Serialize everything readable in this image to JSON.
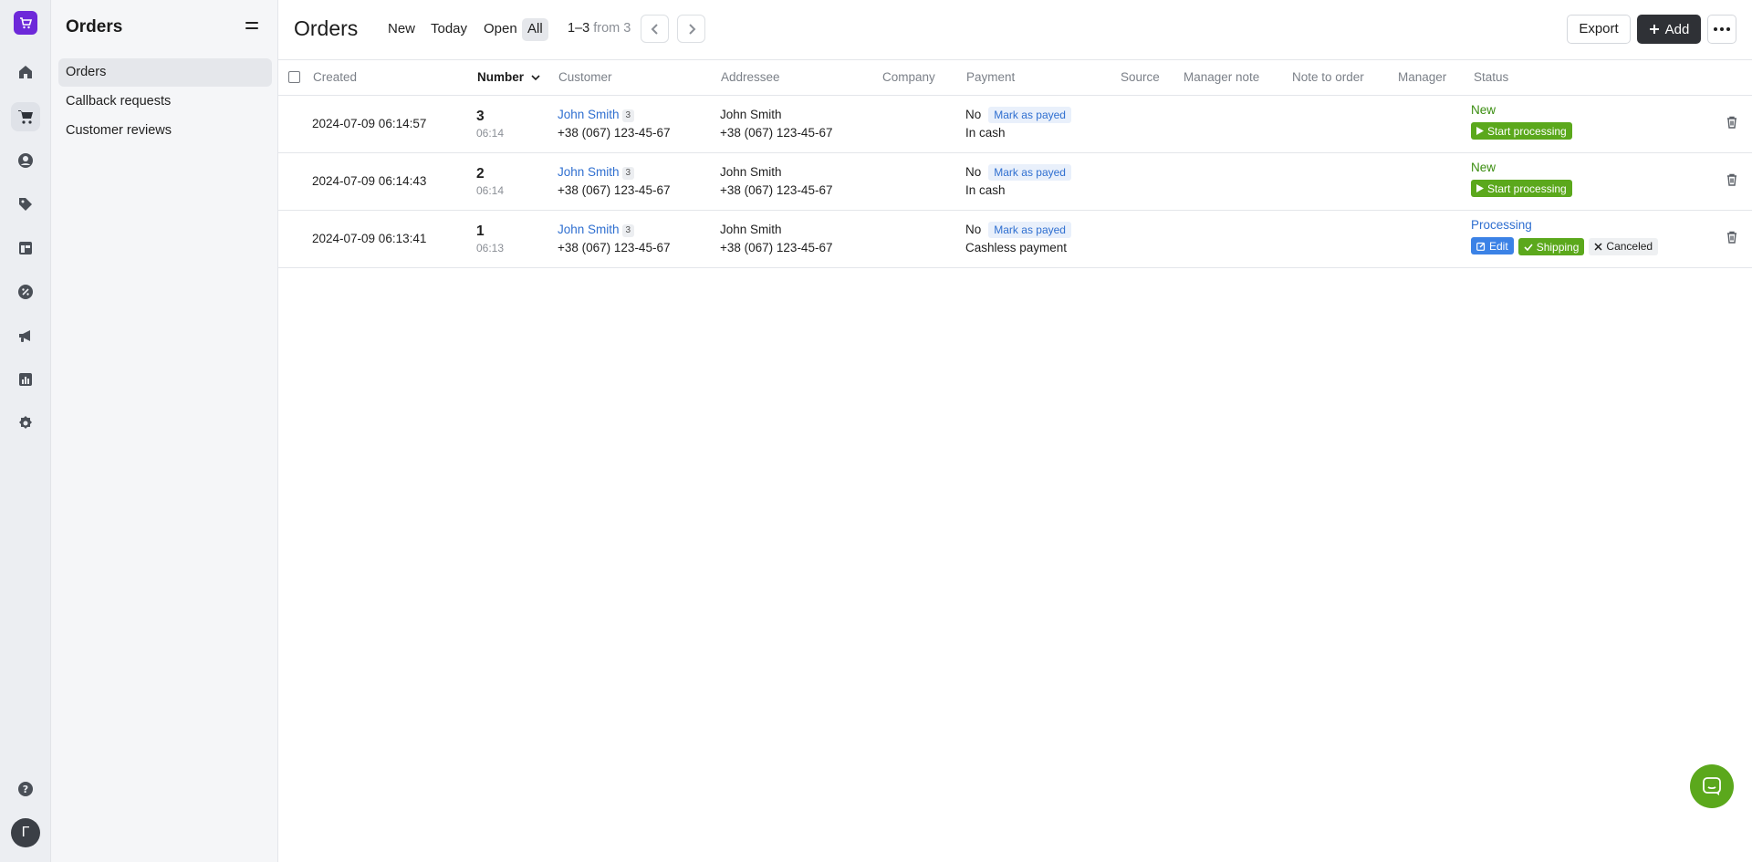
{
  "rail": {
    "items": [
      "home-icon",
      "cart-icon",
      "user-icon",
      "tag-icon",
      "layout-icon",
      "discount-icon",
      "megaphone-icon",
      "chart-icon",
      "settings-icon"
    ],
    "help_icon": "help-icon",
    "avatar_letter": "Г",
    "brand_color": "#6d28d9"
  },
  "sidebar": {
    "title": "Orders",
    "items": [
      {
        "label": "Orders"
      },
      {
        "label": "Callback requests"
      },
      {
        "label": "Customer reviews"
      }
    ]
  },
  "header": {
    "title": "Orders",
    "filters": [
      "New",
      "Today",
      "Open",
      "All"
    ],
    "range": "1–3",
    "range_from": "from 3",
    "export_label": "Export",
    "add_label": "Add"
  },
  "table": {
    "columns": [
      "Created",
      "Number",
      "Customer",
      "Addressee",
      "Company",
      "Payment",
      "Source",
      "Manager note",
      "Note to order",
      "Manager",
      "Status"
    ],
    "rows": [
      {
        "created": "2024-07-09 06:14:57",
        "number": "3",
        "time": "06:14",
        "customer": "John Smith",
        "customer_count": "3",
        "customer_phone": "+38 (067) 123-45-67",
        "addressee": "John Smith",
        "addressee_phone": "+38 (067) 123-45-67",
        "paid": "No",
        "mark_label": "Mark as payed",
        "method": "In cash",
        "status": "New",
        "actions": [
          "Start processing"
        ]
      },
      {
        "created": "2024-07-09 06:14:43",
        "number": "2",
        "time": "06:14",
        "customer": "John Smith",
        "customer_count": "3",
        "customer_phone": "+38 (067) 123-45-67",
        "addressee": "John Smith",
        "addressee_phone": "+38 (067) 123-45-67",
        "paid": "No",
        "mark_label": "Mark as payed",
        "method": "In cash",
        "status": "New",
        "actions": [
          "Start processing"
        ]
      },
      {
        "created": "2024-07-09 06:13:41",
        "number": "1",
        "time": "06:13",
        "customer": "John Smith",
        "customer_count": "3",
        "customer_phone": "+38 (067) 123-45-67",
        "addressee": "John Smith",
        "addressee_phone": "+38 (067) 123-45-67",
        "paid": "No",
        "mark_label": "Mark as payed",
        "method": "Cashless payment",
        "status": "Processing",
        "actions": [
          "Edit",
          "Shipping",
          "Canceled"
        ]
      }
    ]
  },
  "colors": {
    "accent_green": "#5ba81c",
    "accent_blue": "#2f6fd0",
    "dark_button": "#2f3136"
  }
}
